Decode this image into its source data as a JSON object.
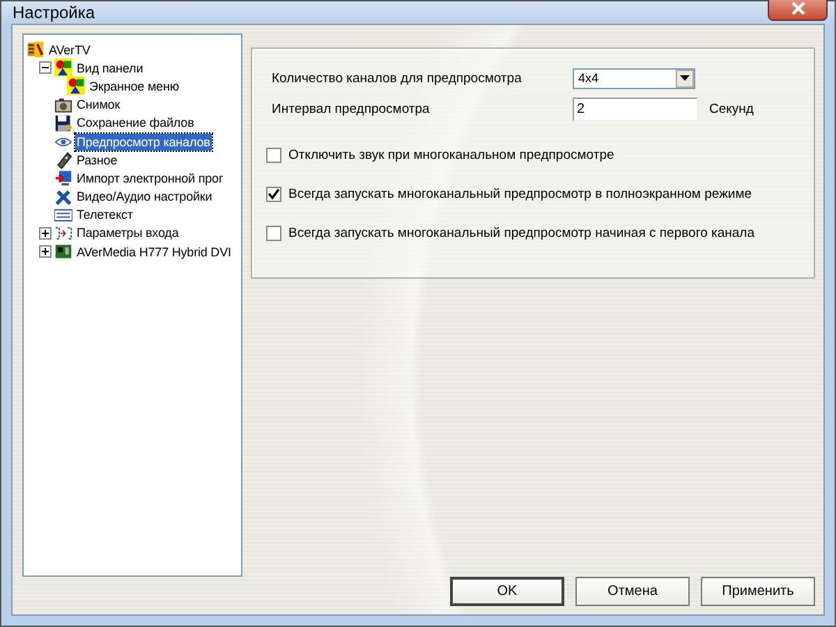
{
  "window": {
    "title": "Настройка"
  },
  "tree": {
    "items": [
      {
        "label": "AVerTV",
        "selected": false,
        "children": [
          {
            "label": "Вид панели",
            "selected": false,
            "expanded": true,
            "children": [
              {
                "label": "Экранное меню",
                "selected": false
              }
            ]
          },
          {
            "label": "Снимок",
            "selected": false
          },
          {
            "label": "Сохранение файлов",
            "selected": false
          },
          {
            "label": "Предпросмотр каналов",
            "selected": true
          },
          {
            "label": "Разное",
            "selected": false
          },
          {
            "label": "Импорт электронной прог",
            "selected": false
          },
          {
            "label": "Видео/Аудио настройки",
            "selected": false
          },
          {
            "label": "Телетекст",
            "selected": false
          },
          {
            "label": "Параметры входа",
            "selected": false,
            "expanded": false
          },
          {
            "label": "AVerMedia H777 Hybrid DVI",
            "selected": false,
            "expanded": false
          }
        ]
      }
    ]
  },
  "preview": {
    "channel_count": {
      "label": "Количество каналов для предпросмотра",
      "value": "4x4"
    },
    "interval": {
      "label": "Интервал предпросмотра",
      "value": "2",
      "unit": "Секунд"
    },
    "options": [
      {
        "label": "Отключить звук при многоканальном предпросмотре",
        "checked": false
      },
      {
        "label": "Всегда запускать многоканальный предпросмотр в полноэкранном режиме",
        "checked": true
      },
      {
        "label": "Всегда запускать многоканальный предпросмотр начиная с первого канала",
        "checked": false
      }
    ]
  },
  "buttons": [
    {
      "label": "OK",
      "default": true
    },
    {
      "label": "Отмена",
      "default": false
    },
    {
      "label": "Применить",
      "default": false
    }
  ]
}
